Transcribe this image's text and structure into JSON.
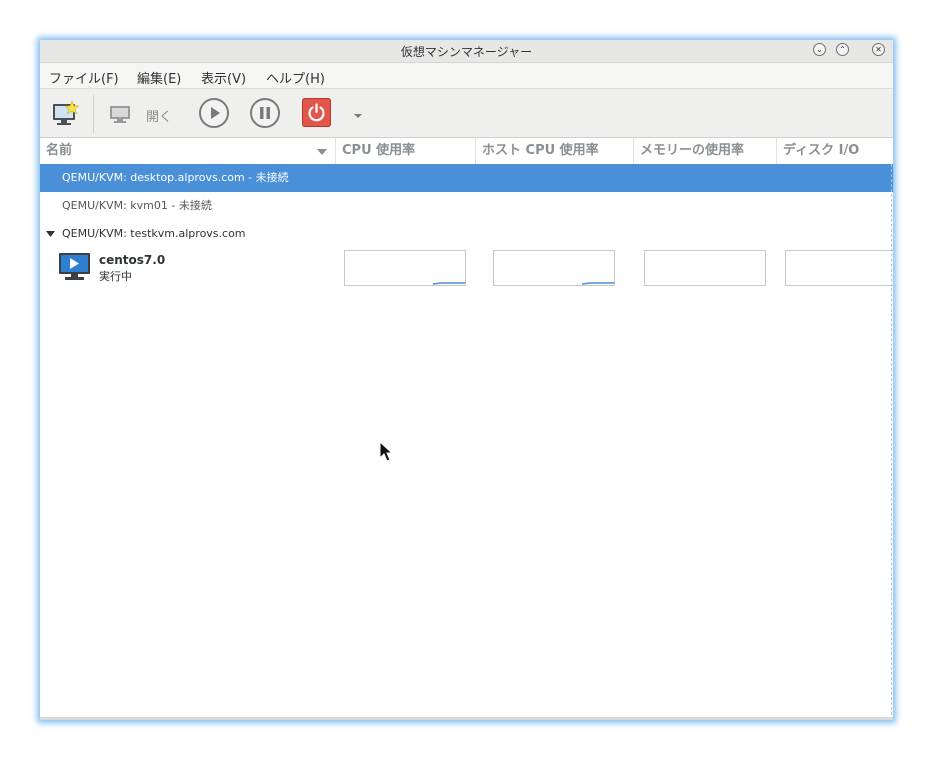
{
  "window": {
    "title": "仮想マシンマネージャー"
  },
  "menu": [
    "ファイル(F)",
    "編集(E)",
    "表示(V)",
    "ヘルプ(H)"
  ],
  "toolbar": {
    "open_label": "開く"
  },
  "columns": {
    "name": "名前",
    "cpu": "CPU 使用率",
    "host_cpu": "ホスト CPU 使用率",
    "memory": "メモリーの使用率",
    "disk": "ディスク I/O"
  },
  "connections": [
    {
      "label": "QEMU/KVM: desktop.alprovs.com - 未接続",
      "selected": true
    },
    {
      "label": "QEMU/KVM: kvm01 - 未接続",
      "selected": false
    },
    {
      "label": "QEMU/KVM: testkvm.alprovs.com",
      "selected": false,
      "expanded": true
    }
  ],
  "vm": {
    "name": "centos7.0",
    "status": "実行中",
    "cpu_usage_level": 0.03,
    "host_cpu_usage_level": 0.03
  },
  "colors": {
    "selection": "#4a90d9",
    "graph_line": "#4a90d9",
    "shutdown_button": "#e2564a"
  }
}
